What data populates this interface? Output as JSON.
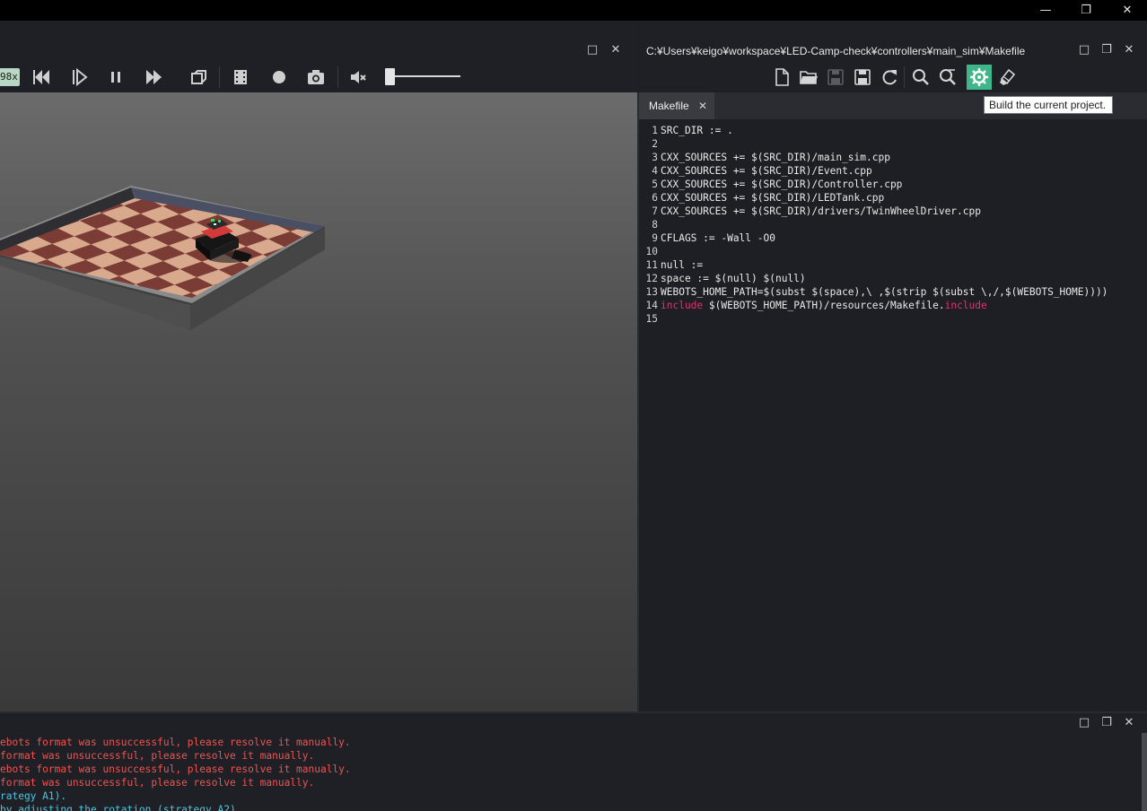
{
  "window": {
    "controls": {
      "minimize": "—",
      "restore": "❐",
      "close": "✕"
    }
  },
  "view_panel": {
    "speed": "98x",
    "toolbar": {
      "icons": [
        "step-back-icon",
        "step-icon",
        "pause-icon",
        "fast-forward-icon",
        "reset-view-icon",
        "movie-icon",
        "record-icon",
        "screenshot-icon",
        "mute-icon"
      ]
    },
    "volume_level": 0.03,
    "panel_controls": {
      "maximize": "□",
      "close": "✕"
    }
  },
  "editor": {
    "path": "C:¥Users¥keigo¥workspace¥LED-Camp-check¥controllers¥main_sim¥Makefile",
    "panel_controls": {
      "maximize": "□",
      "float": "❐",
      "close": "✕"
    },
    "tab": {
      "label": "Makefile",
      "close": "✕"
    },
    "tooltip": "Build the current project.",
    "toolbar_icons": [
      "new-file-icon",
      "open-file-icon",
      "save-icon",
      "save-all-icon",
      "revert-icon",
      "find-icon",
      "replace-icon",
      "build-icon",
      "clean-icon"
    ],
    "lines": [
      {
        "n": "1",
        "code": "SRC_DIR := ."
      },
      {
        "n": "2",
        "code": ""
      },
      {
        "n": "3",
        "code": "CXX_SOURCES += $(SRC_DIR)/main_sim.cpp"
      },
      {
        "n": "4",
        "code": "CXX_SOURCES += $(SRC_DIR)/Event.cpp"
      },
      {
        "n": "5",
        "code": "CXX_SOURCES += $(SRC_DIR)/Controller.cpp"
      },
      {
        "n": "6",
        "code": "CXX_SOURCES += $(SRC_DIR)/LEDTank.cpp"
      },
      {
        "n": "7",
        "code": "CXX_SOURCES += $(SRC_DIR)/drivers/TwinWheelDriver.cpp"
      },
      {
        "n": "8",
        "code": ""
      },
      {
        "n": "9",
        "code": "CFLAGS := -Wall -O0"
      },
      {
        "n": "10",
        "code": ""
      },
      {
        "n": "11",
        "code": "null :="
      },
      {
        "n": "12",
        "code": "space := $(null) $(null)"
      },
      {
        "n": "13",
        "code": "WEBOTS_HOME_PATH=$(subst $(space),\\ ,$(strip $(subst \\,/,$(WEBOTS_HOME))))"
      },
      {
        "n": "14",
        "code_kw1": "include",
        "code_mid": " $(WEBOTS_HOME_PATH)/resources/Makefile.",
        "code_kw2": "include"
      },
      {
        "n": "15",
        "code": ""
      }
    ]
  },
  "console": {
    "panel_controls": {
      "maximize": "□",
      "float": "❐",
      "close": "✕"
    },
    "lines": [
      {
        "text": "ebots format was unsuccessful, please resolve it manually.",
        "kind": "err"
      },
      {
        "text": "format was unsuccessful, please resolve it manually.",
        "kind": "err"
      },
      {
        "text": "ebots format was unsuccessful, please resolve it manually.",
        "kind": "err"
      },
      {
        "text": "format was unsuccessful, please resolve it manually.",
        "kind": "err"
      },
      {
        "text": "rategy A1).",
        "kind": "info"
      },
      {
        "text": "by adjusting the rotation (strategy A2).",
        "kind": "info"
      }
    ]
  },
  "colors": {
    "accent_build": "#3fb58a",
    "error": "#ef5350",
    "info": "#4dc3e0",
    "keyword": "#e3306e"
  }
}
